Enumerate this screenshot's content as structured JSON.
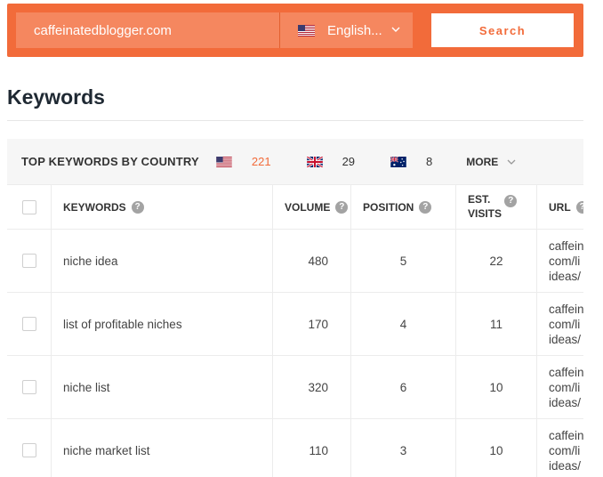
{
  "search": {
    "domain_value": "caffeinatedblogger.com",
    "language_label": "English...",
    "search_button_label": "Search"
  },
  "page_title": "Keywords",
  "countries": {
    "title": "TOP KEYWORDS BY COUNTRY",
    "items": [
      {
        "flag": "us-flag-icon",
        "count": "221",
        "color": "#f26b3a"
      },
      {
        "flag": "uk-flag-icon",
        "count": "29",
        "color": "#333333"
      },
      {
        "flag": "au-flag-icon",
        "count": "8",
        "color": "#333333"
      }
    ],
    "more_label": "MORE"
  },
  "table": {
    "columns": {
      "keywords": "KEYWORDS",
      "volume": "VOLUME",
      "position": "POSITION",
      "est_visits_line1": "EST.",
      "est_visits_line2": "VISITS",
      "url": "URL"
    },
    "rows": [
      {
        "keyword": "niche idea",
        "volume": "480",
        "position": "5",
        "visits": "22",
        "url_lines": [
          "caffein",
          "com/li",
          "ideas/"
        ]
      },
      {
        "keyword": "list of profitable niches",
        "volume": "170",
        "position": "4",
        "visits": "11",
        "url_lines": [
          "caffein",
          "com/li",
          "ideas/"
        ]
      },
      {
        "keyword": "niche list",
        "volume": "320",
        "position": "6",
        "visits": "10",
        "url_lines": [
          "caffein",
          "com/li",
          "ideas/"
        ]
      },
      {
        "keyword": "niche market list",
        "volume": "110",
        "position": "3",
        "visits": "10",
        "url_lines": [
          "caffein",
          "com/li",
          "ideas/"
        ]
      }
    ]
  },
  "colors": {
    "brand": "#f26b3a",
    "input_bg": "#f5875f",
    "row_alt": "#f8f8f8"
  }
}
